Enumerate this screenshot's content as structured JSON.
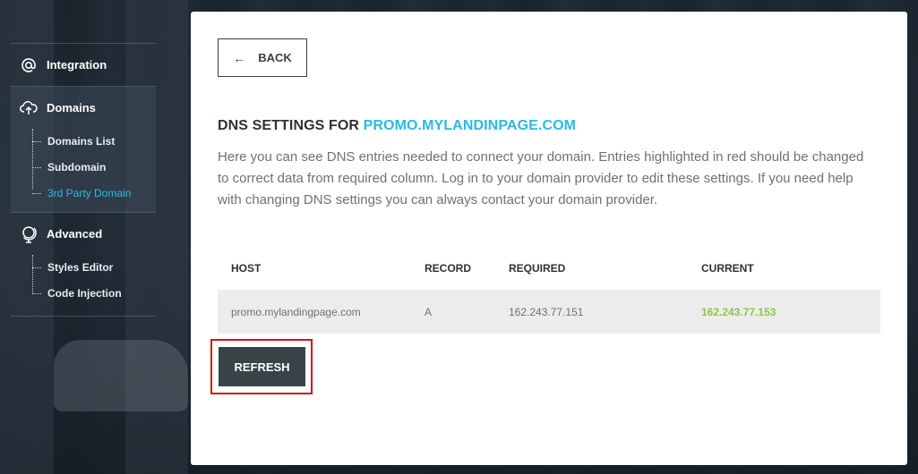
{
  "sidebar": {
    "integration": {
      "label": "Integration",
      "icon": "at-icon"
    },
    "domains": {
      "label": "Domains",
      "icon": "cloud-upload-icon",
      "items": [
        {
          "label": "Domains List"
        },
        {
          "label": "Subdomain"
        },
        {
          "label": "3rd Party Domain",
          "active": true
        }
      ]
    },
    "advanced": {
      "label": "Advanced",
      "icon": "globe-icon",
      "items": [
        {
          "label": "Styles Editor"
        },
        {
          "label": "Code Injection"
        }
      ]
    }
  },
  "main": {
    "back_label": "BACK",
    "title_prefix": "DNS SETTINGS FOR",
    "title_domain": "PROMO.MYLANDINPAGE.COM",
    "description": "Here you can see DNS entries needed to connect your domain. Entries highlighted in red should be changed to correct data from required column. Log in to your domain provider to edit these settings. If you need help with changing DNS settings you can always contact your domain provider.",
    "table": {
      "headers": [
        "HOST",
        "RECORD",
        "REQUIRED",
        "CURRENT"
      ],
      "rows": [
        {
          "host": "promo.mylandingpage.com",
          "record": "A",
          "required": "162.243.77.151",
          "current": "162.243.77.153"
        }
      ]
    },
    "refresh_label": "REFRESH"
  },
  "colors": {
    "accent": "#2db8e6",
    "ok": "#8cc63f",
    "highlight": "#d0141b",
    "button_dark": "#3a4348"
  }
}
